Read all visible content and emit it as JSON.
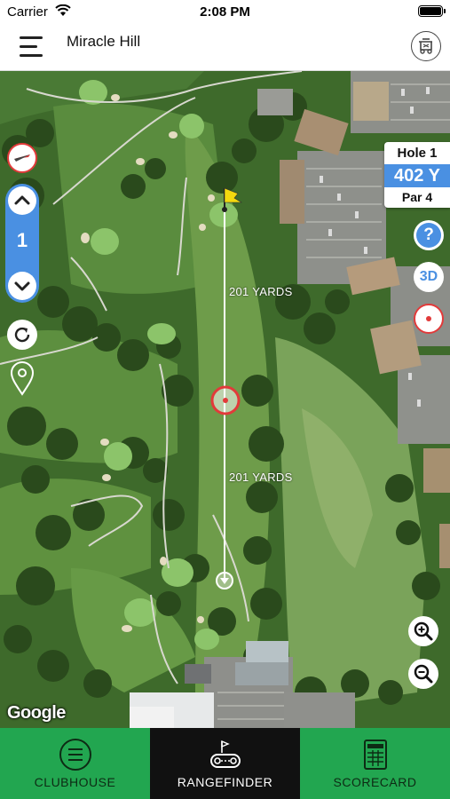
{
  "status_bar": {
    "carrier": "Carrier",
    "time": "2:08 PM"
  },
  "header": {
    "course_name": "Miracle Hill",
    "cart_icon": "golf-cart-icon",
    "menu_icon": "hamburger-menu-icon"
  },
  "hole_selector": {
    "current_hole": "1"
  },
  "hole_info": {
    "hole_label": "Hole 1",
    "yards": "402 Y",
    "par": "Par 4"
  },
  "controls": {
    "help_label": "?",
    "view_3d_label": "3D"
  },
  "yardages": {
    "to_pin": "201 YARDS",
    "from_tee": "201 YARDS"
  },
  "map_attribution": "Google",
  "tabs": [
    {
      "label": "CLUBHOUSE",
      "icon": "list-circle-icon",
      "active": false
    },
    {
      "label": "RANGEFINDER",
      "icon": "rangefinder-icon",
      "active": true
    },
    {
      "label": "SCORECARD",
      "icon": "scorecard-icon",
      "active": false
    }
  ],
  "colors": {
    "accent_blue": "#4a90e2",
    "tab_green": "#22a650",
    "tab_active": "#111111",
    "target_red": "#e23a3a",
    "pin_flag": "#f4d90e"
  }
}
